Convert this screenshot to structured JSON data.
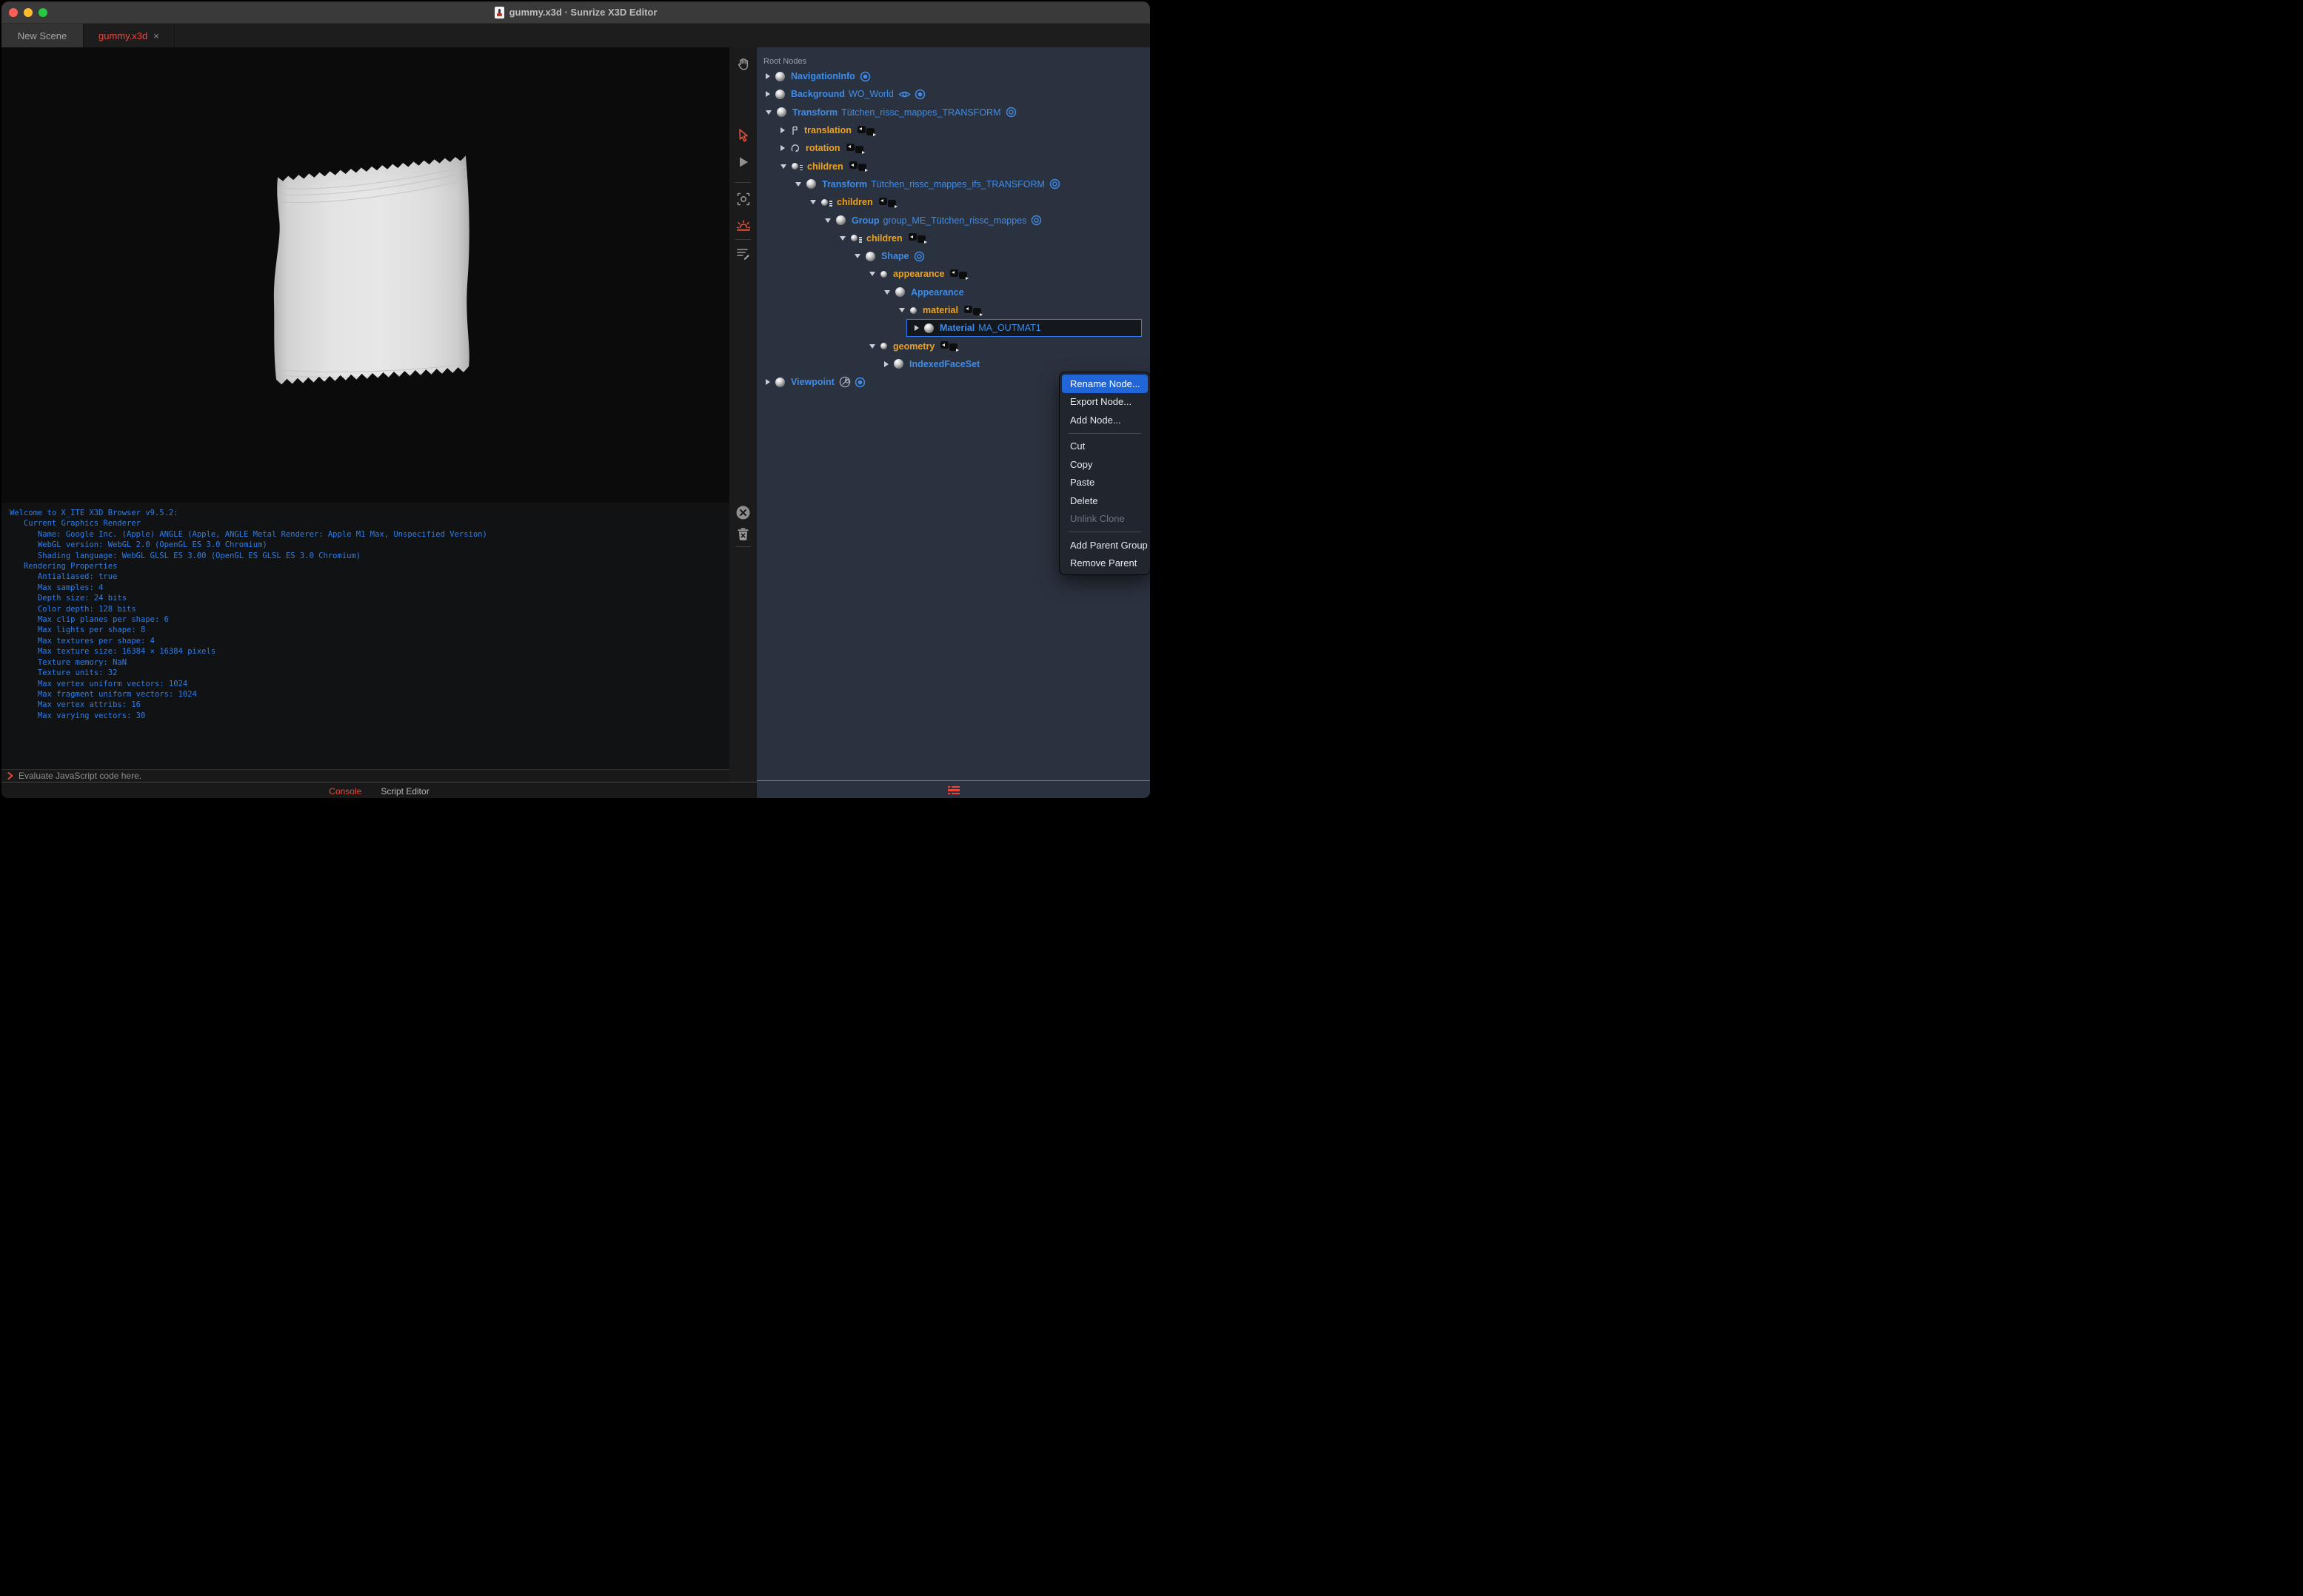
{
  "window": {
    "title": "gummy.x3d · Sunrize X3D Editor"
  },
  "tabs": {
    "items": [
      {
        "label": "New Scene",
        "active": false
      },
      {
        "label": "gummy.x3d",
        "active": true
      }
    ],
    "close_glyph": "×"
  },
  "toolbar": {
    "buttons": [
      "pan-hand",
      "select-arrow",
      "play",
      "snapshot",
      "sunrise-light",
      "script-edit"
    ]
  },
  "console": {
    "lines": [
      "Welcome to X_ITE X3D Browser v9.5.2:",
      "   Current Graphics Renderer",
      "      Name: Google Inc. (Apple) ANGLE (Apple, ANGLE Metal Renderer: Apple M1 Max, Unspecified Version)",
      "      WebGL version: WebGL 2.0 (OpenGL ES 3.0 Chromium)",
      "      Shading language: WebGL GLSL ES 3.00 (OpenGL ES GLSL ES 3.0 Chromium)",
      "   Rendering Properties",
      "      Antialiased: true",
      "      Max samples: 4",
      "      Depth size: 24 bits",
      "      Color depth: 128 bits",
      "      Max clip planes per shape: 6",
      "      Max lights per shape: 8",
      "      Max textures per shape: 4",
      "      Max texture size: 16384 × 16384 pixels",
      "      Texture memory: NaN",
      "      Texture units: 32",
      "      Max vertex uniform vectors: 1024",
      "      Max fragment uniform vectors: 1024",
      "      Max vertex attribs: 16",
      "      Max varying vectors: 30"
    ],
    "prompt_placeholder": "Evaluate JavaScript code here."
  },
  "statusbar": {
    "tabs": [
      {
        "label": "Console",
        "active": true
      },
      {
        "label": "Script Editor",
        "active": false
      }
    ]
  },
  "outline": {
    "header": "Root Nodes",
    "rows": [
      {
        "kind": "node",
        "level": 0,
        "arrow": "right",
        "name": "NavigationInfo",
        "def": "",
        "trail": [
          "radio"
        ]
      },
      {
        "kind": "node",
        "level": 0,
        "arrow": "right",
        "name": "Background",
        "def": "WO_World",
        "trail": [
          "eye",
          "radio"
        ]
      },
      {
        "kind": "node",
        "level": 0,
        "arrow": "down",
        "name": "Transform",
        "def": "Tütchen_rissc_mappes_TRANSFORM",
        "trail": [
          "ring"
        ]
      },
      {
        "kind": "field",
        "level": 1,
        "arrow": "right",
        "icon": "translation",
        "name": "translation",
        "routes": true
      },
      {
        "kind": "field",
        "level": 1,
        "arrow": "right",
        "icon": "rotation",
        "name": "rotation",
        "routes": true
      },
      {
        "kind": "field",
        "level": 1,
        "arrow": "down",
        "icon": "children",
        "name": "children",
        "routes": true
      },
      {
        "kind": "node",
        "level": 2,
        "arrow": "down",
        "name": "Transform",
        "def": "Tütchen_rissc_mappes_ifs_TRANSFORM",
        "trail": [
          "ring"
        ]
      },
      {
        "kind": "field",
        "level": 3,
        "arrow": "down",
        "icon": "children",
        "name": "children",
        "routes": true
      },
      {
        "kind": "node",
        "level": 4,
        "arrow": "down",
        "name": "Group",
        "def": "group_ME_Tütchen_rissc_mappes",
        "trail": [
          "ring"
        ]
      },
      {
        "kind": "field",
        "level": 5,
        "arrow": "down",
        "icon": "children",
        "name": "children",
        "routes": true
      },
      {
        "kind": "node",
        "level": 6,
        "arrow": "down",
        "name": "Shape",
        "def": "",
        "trail": [
          "ring"
        ]
      },
      {
        "kind": "field",
        "level": 7,
        "arrow": "down",
        "icon": "sphere",
        "name": "appearance",
        "routes": true
      },
      {
        "kind": "node",
        "level": 8,
        "arrow": "down",
        "name": "Appearance",
        "def": "",
        "trail": []
      },
      {
        "kind": "field",
        "level": 9,
        "arrow": "down",
        "icon": "sphere",
        "name": "material",
        "routes": true
      },
      {
        "kind": "node",
        "level": 10,
        "arrow": "right",
        "name": "Material",
        "def": "MA_OUTMAT1",
        "trail": [],
        "selected": true
      },
      {
        "kind": "field",
        "level": 7,
        "arrow": "down",
        "icon": "sphere",
        "name": "geometry",
        "routes": true
      },
      {
        "kind": "node",
        "level": 8,
        "arrow": "right",
        "name": "IndexedFaceSet",
        "def": "",
        "trail": []
      },
      {
        "kind": "node",
        "level": 0,
        "arrow": "right",
        "name": "Viewpoint",
        "def": "",
        "trail": [
          "wrench",
          "radio"
        ]
      }
    ]
  },
  "context_menu": {
    "items": [
      {
        "label": "Rename Node...",
        "state": "highlighted"
      },
      {
        "label": "Export Node...",
        "state": "normal"
      },
      {
        "label": "Add Node...",
        "state": "normal"
      },
      {
        "type": "separator"
      },
      {
        "label": "Cut",
        "state": "normal"
      },
      {
        "label": "Copy",
        "state": "normal"
      },
      {
        "label": "Paste",
        "state": "normal"
      },
      {
        "label": "Delete",
        "state": "normal"
      },
      {
        "label": "Unlink Clone",
        "state": "disabled"
      },
      {
        "type": "separator"
      },
      {
        "label": "Add Parent Group",
        "state": "normal"
      },
      {
        "label": "Remove Parent",
        "state": "normal"
      }
    ]
  },
  "colors": {
    "node_blue": "#3f8ce8",
    "field_orange": "#efa11c",
    "tab_red": "#e8463f",
    "console_blue": "#2e7ee7",
    "menu_highlight": "#2066d8",
    "panel_bg": "#2b323f",
    "selection_border": "#2f7bf4"
  }
}
